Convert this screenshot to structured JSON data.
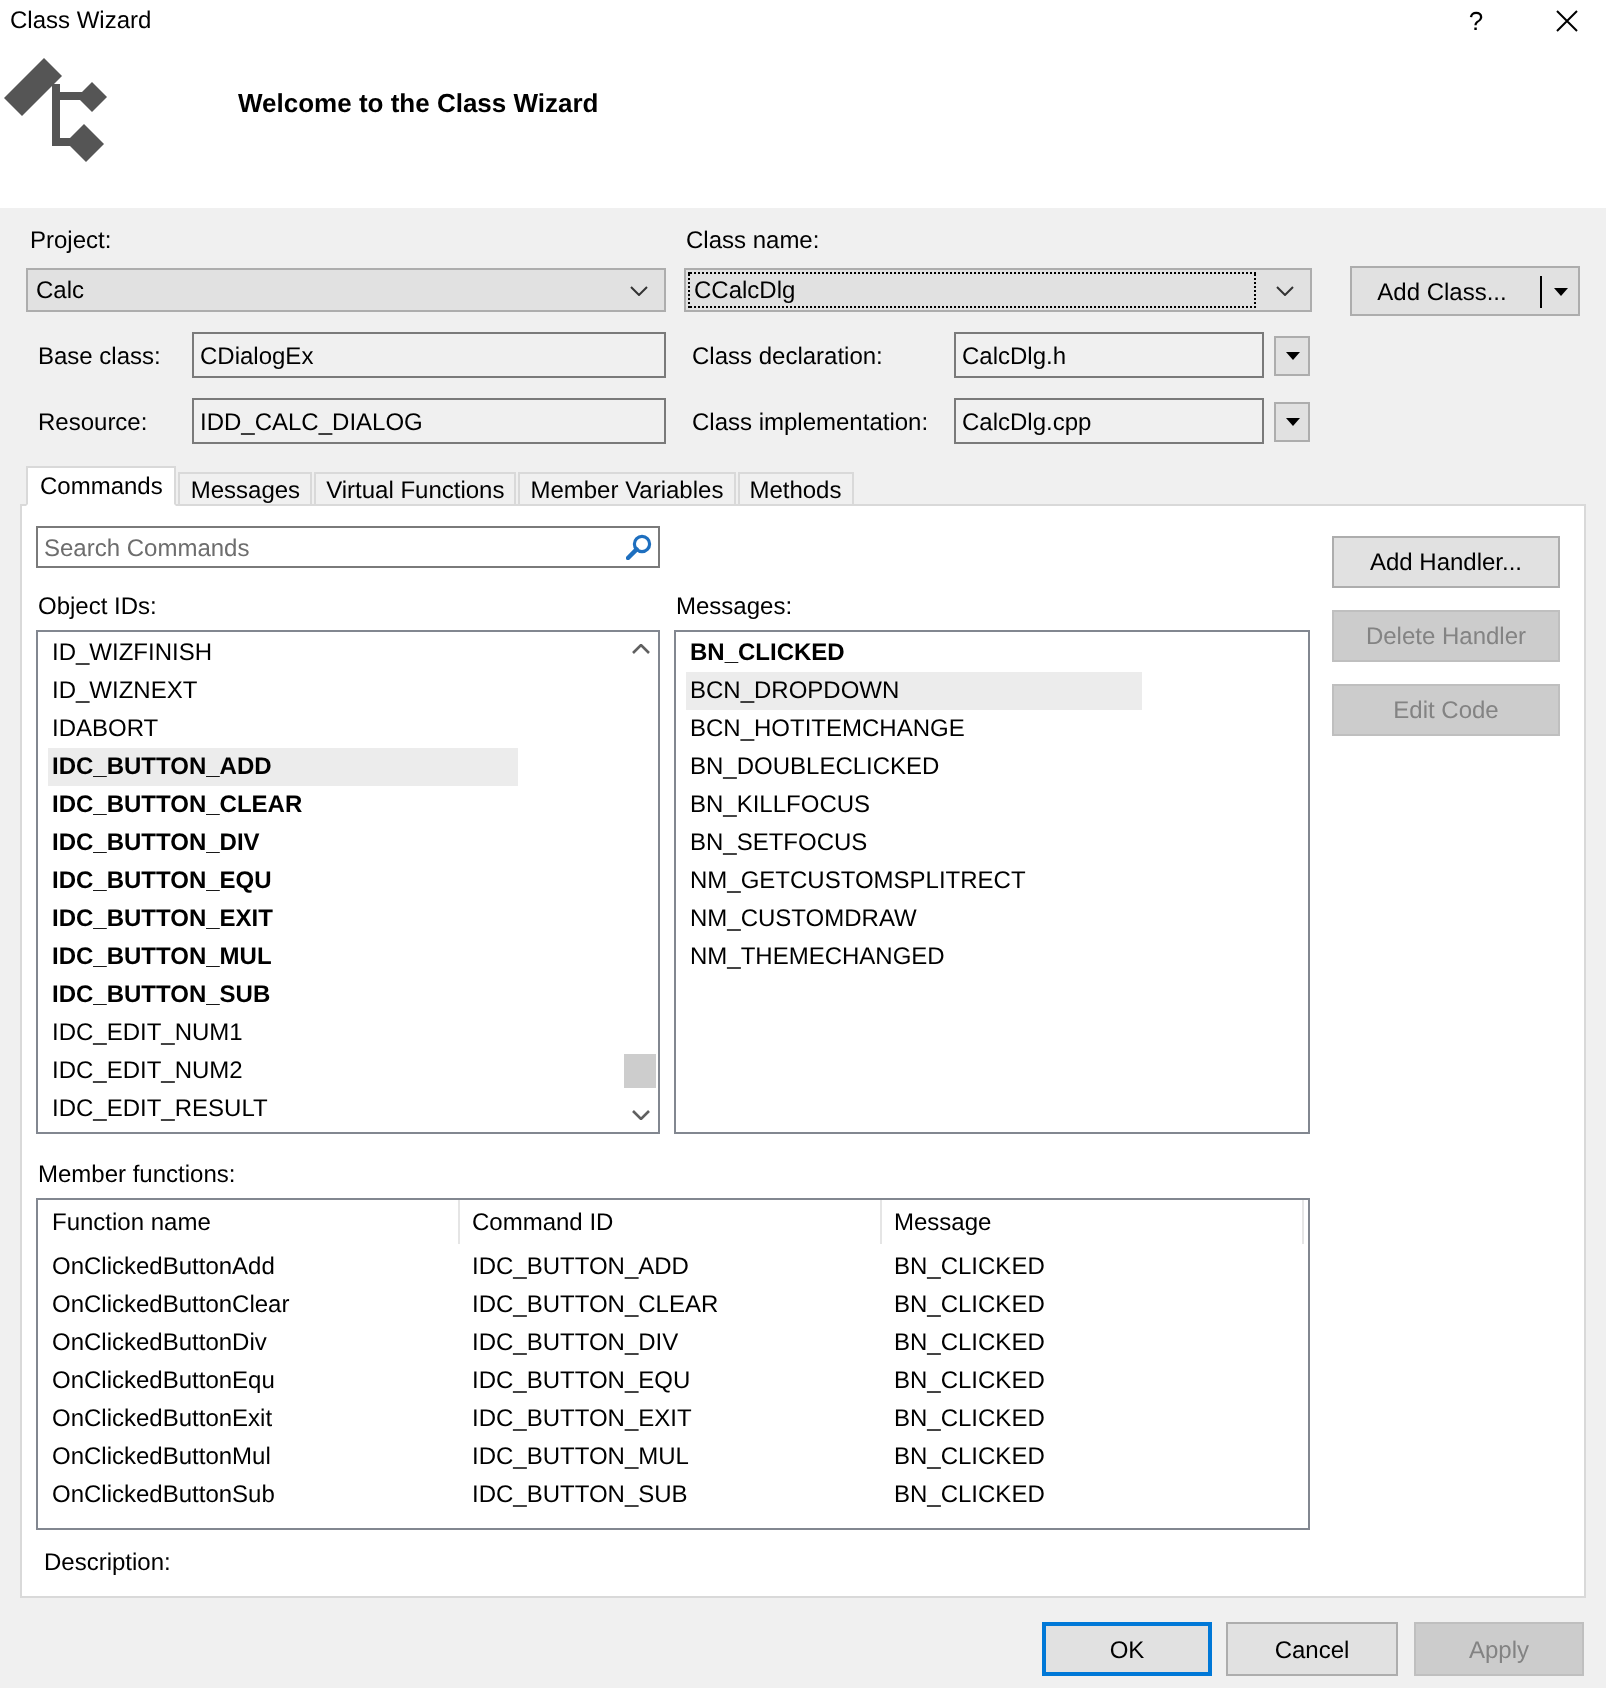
{
  "window": {
    "title": "Class Wizard",
    "help_button": "?"
  },
  "header": {
    "title": "Welcome to the Class Wizard"
  },
  "form": {
    "project": {
      "label": "Project:",
      "value": "Calc"
    },
    "class_name": {
      "label": "Class name:",
      "value": "CCalcDlg",
      "focused": true
    },
    "add_class_button": {
      "label": "Add Class..."
    },
    "base_class": {
      "label": "Base class:",
      "value": "CDialogEx"
    },
    "class_declaration": {
      "label": "Class declaration:",
      "value": "CalcDlg.h"
    },
    "resource": {
      "label": "Resource:",
      "value": "IDD_CALC_DIALOG"
    },
    "class_implementation": {
      "label": "Class implementation:",
      "value": "CalcDlg.cpp"
    }
  },
  "tabs": [
    {
      "label": "Commands",
      "selected": true
    },
    {
      "label": "Messages",
      "selected": false
    },
    {
      "label": "Virtual Functions",
      "selected": false
    },
    {
      "label": "Member Variables",
      "selected": false
    },
    {
      "label": "Methods",
      "selected": false
    }
  ],
  "commands": {
    "search": {
      "placeholder": "Search Commands"
    },
    "object_ids": {
      "label": "Object IDs:",
      "items": [
        {
          "text": "ID_WIZFINISH",
          "bold": false,
          "selected": false
        },
        {
          "text": "ID_WIZNEXT",
          "bold": false,
          "selected": false
        },
        {
          "text": "IDABORT",
          "bold": false,
          "selected": false
        },
        {
          "text": "IDC_BUTTON_ADD",
          "bold": true,
          "selected": true
        },
        {
          "text": "IDC_BUTTON_CLEAR",
          "bold": true,
          "selected": false
        },
        {
          "text": "IDC_BUTTON_DIV",
          "bold": true,
          "selected": false
        },
        {
          "text": "IDC_BUTTON_EQU",
          "bold": true,
          "selected": false
        },
        {
          "text": "IDC_BUTTON_EXIT",
          "bold": true,
          "selected": false
        },
        {
          "text": "IDC_BUTTON_MUL",
          "bold": true,
          "selected": false
        },
        {
          "text": "IDC_BUTTON_SUB",
          "bold": true,
          "selected": false
        },
        {
          "text": "IDC_EDIT_NUM1",
          "bold": false,
          "selected": false
        },
        {
          "text": "IDC_EDIT_NUM2",
          "bold": false,
          "selected": false
        },
        {
          "text": "IDC_EDIT_RESULT",
          "bold": false,
          "selected": false
        }
      ]
    },
    "messages": {
      "label": "Messages:",
      "items": [
        {
          "text": "BN_CLICKED",
          "bold": true,
          "selected": false
        },
        {
          "text": "BCN_DROPDOWN",
          "bold": false,
          "selected": true
        },
        {
          "text": "BCN_HOTITEMCHANGE",
          "bold": false,
          "selected": false
        },
        {
          "text": "BN_DOUBLECLICKED",
          "bold": false,
          "selected": false
        },
        {
          "text": "BN_KILLFOCUS",
          "bold": false,
          "selected": false
        },
        {
          "text": "BN_SETFOCUS",
          "bold": false,
          "selected": false
        },
        {
          "text": "NM_GETCUSTOMSPLITRECT",
          "bold": false,
          "selected": false
        },
        {
          "text": "NM_CUSTOMDRAW",
          "bold": false,
          "selected": false
        },
        {
          "text": "NM_THEMECHANGED",
          "bold": false,
          "selected": false
        }
      ]
    },
    "buttons": [
      {
        "label": "Add Handler...",
        "disabled": false
      },
      {
        "label": "Delete Handler",
        "disabled": true
      },
      {
        "label": "Edit Code",
        "disabled": true
      }
    ],
    "member_functions": {
      "label": "Member functions:",
      "columns": [
        "Function name",
        "Command ID",
        "Message"
      ],
      "rows": [
        [
          "OnClickedButtonAdd",
          "IDC_BUTTON_ADD",
          "BN_CLICKED"
        ],
        [
          "OnClickedButtonClear",
          "IDC_BUTTON_CLEAR",
          "BN_CLICKED"
        ],
        [
          "OnClickedButtonDiv",
          "IDC_BUTTON_DIV",
          "BN_CLICKED"
        ],
        [
          "OnClickedButtonEqu",
          "IDC_BUTTON_EQU",
          "BN_CLICKED"
        ],
        [
          "OnClickedButtonExit",
          "IDC_BUTTON_EXIT",
          "BN_CLICKED"
        ],
        [
          "OnClickedButtonMul",
          "IDC_BUTTON_MUL",
          "BN_CLICKED"
        ],
        [
          "OnClickedButtonSub",
          "IDC_BUTTON_SUB",
          "BN_CLICKED"
        ]
      ]
    },
    "description": {
      "label": "Description:"
    }
  },
  "dialog_buttons": [
    {
      "label": "OK",
      "default": true,
      "disabled": false
    },
    {
      "label": "Cancel",
      "default": false,
      "disabled": false
    },
    {
      "label": "Apply",
      "default": false,
      "disabled": true
    }
  ]
}
